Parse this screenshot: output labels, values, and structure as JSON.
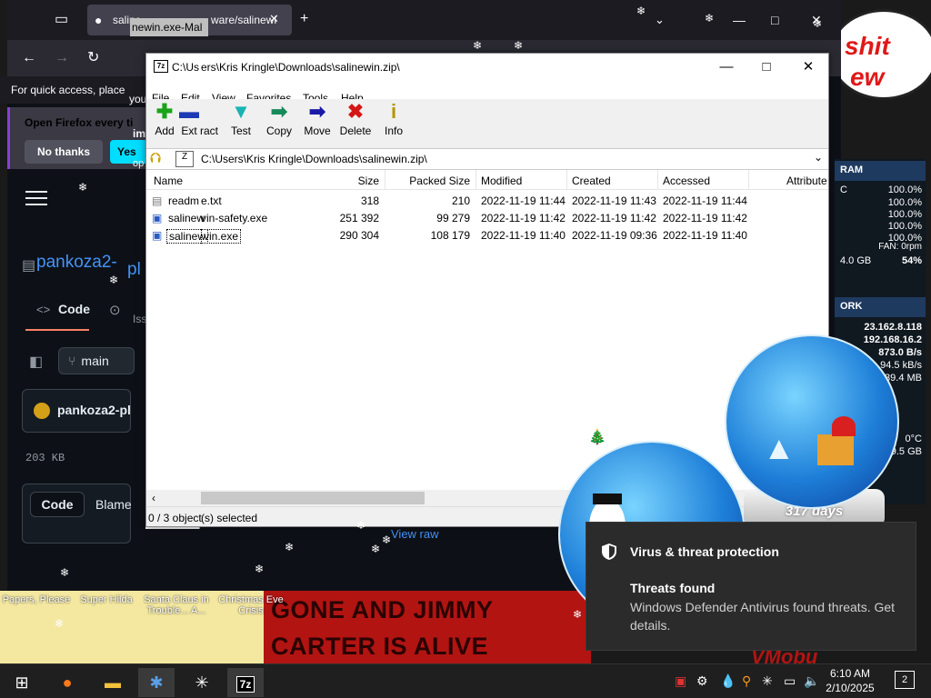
{
  "firefox": {
    "tab_title": "saline",
    "tab_url_fragment": "ware/salinewi",
    "tab_overlay": "newin.exe-Mal",
    "quick_access": "For quick access, place",
    "quick_access_tail": "you",
    "notice_title": "Open Firefox every ti",
    "notice_tail": "ime",
    "no_thanks": "No thanks",
    "yes": "Yes",
    "yes_tail": "op"
  },
  "github": {
    "repo_name": "pankoza2-",
    "repo_tail": "pl",
    "code_tab": "Code",
    "issues_tab": "Iss",
    "branch": "main",
    "commit_author": "pankoza2-pl",
    "file_size": "203 KB",
    "code_button": "Code",
    "blame_button": "Blame",
    "view_raw": "View raw"
  },
  "sevenzip": {
    "title_prefix": "C:\\Us",
    "title": "ers\\Kris Kringle\\Downloads\\salinewin.zip\\",
    "menu_file": "File",
    "menu_edit": "Edit",
    "menus": [
      "View",
      "Favorites",
      "Tools",
      "Help"
    ],
    "toolbar": {
      "add": "Add",
      "extract": "Ext",
      "extract_tail": "ract",
      "test": "Test",
      "copy": "Copy",
      "move": "Move",
      "delete": "Delete",
      "info": "Info"
    },
    "path": "C:\\Users\\Kris Kringle\\Downloads\\salinewin.zip\\",
    "columns": {
      "name": "Name",
      "size": "Size",
      "packed": "Packed Size",
      "modified": "Modified",
      "created": "Created",
      "accessed": "Accessed",
      "attributes": "Attribute"
    },
    "rows": [
      {
        "left": "readm",
        "name": "e.txt",
        "size": "318",
        "packed": "210",
        "modified": "2022-11-19 11:44",
        "created": "2022-11-19 11:43",
        "accessed": "2022-11-19 11:44"
      },
      {
        "left": "salinew",
        "name": "vin-safety.exe",
        "size": "251 392",
        "packed": "99 279",
        "modified": "2022-11-19 11:42",
        "created": "2022-11-19 11:42",
        "accessed": "2022-11-19 11:42"
      },
      {
        "left": "salinew",
        "name": "vin.exe",
        "size": "290 304",
        "packed": "108 179",
        "modified": "2022-11-19 11:40",
        "created": "2022-11-19 09:36",
        "accessed": "2022-11-19 11:40"
      }
    ],
    "status_left": "0 / 3 object",
    "status_right": "(s) selected"
  },
  "monitor": {
    "ram_header": "RAM",
    "ram_c": "C",
    "ram_values": [
      "100.0%",
      "100.0%",
      "100.0%",
      "100.0%",
      "100.0%"
    ],
    "fan": "FAN: 0rpm",
    "mem_total": "4.0 GB",
    "mem_pct": "54%",
    "net_header": "ORK",
    "ip1": "23.162.8.118",
    "ip2": "192.168.16.2",
    "rate1": "873.0 B/s",
    "rate2": "94.5 kB/s",
    "rate3": "39.4 MB",
    "temp": "0°C",
    "disk": "9.5 GB"
  },
  "wallpaper": {
    "bubble_line1": "shit",
    "bubble_line2": "ew",
    "banner_line1": "GONE AND JIMMY",
    "banner_line2": "CARTER IS ALIVE",
    "desktop_icons": [
      "Papers, Please",
      "Super Hilda",
      "Santa Claus in Trouble... A...",
      "Christmas Eve Crisis"
    ],
    "globe_days": "317 days",
    "corner_text": "VMobu"
  },
  "toast": {
    "app": "Virus & threat protection",
    "title": "Threats found",
    "body": "Windows Defender Antivirus found threats. Get details."
  },
  "taskbar": {
    "time": "6:10 AM",
    "date": "2/10/2025",
    "notification_count": "2",
    "sevenzip_label": "7z"
  }
}
